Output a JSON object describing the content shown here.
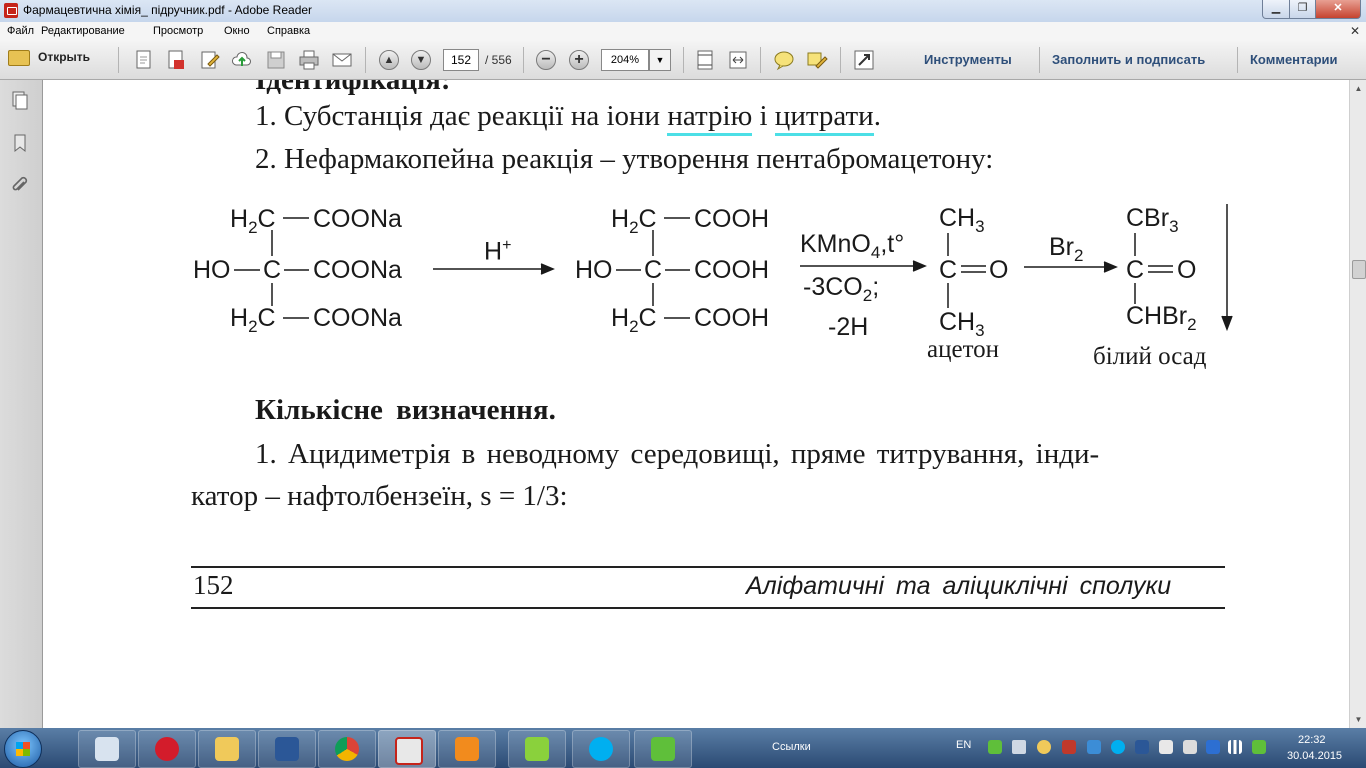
{
  "window": {
    "title": "Фармацевтична хімія_ підручник.pdf - Adobe Reader"
  },
  "menu": [
    "Файл",
    "Редактирование",
    "Просмотр",
    "Окно",
    "Справка"
  ],
  "toolbar": {
    "open_label": "Открыть",
    "page_current": "152",
    "page_total": "/ 556",
    "zoom": "204%",
    "tools_label": "Инструменты",
    "fill_sign_label": "Заполнить и подписать",
    "comments_label": "Комментарии"
  },
  "document": {
    "heading_partial": "Ідентифікація:",
    "item1_prefix": "1. Субстанція дає реакції на іони ",
    "item1_word1": "натрію",
    "item1_mid": " і ",
    "item1_word2": "цитрати",
    "item1_end": ".",
    "item2": "2. Нефармакопейна реакція – утворення пентабромацетону:",
    "reaction": {
      "citrate_top": [
        "H",
        "2",
        "C",
        "COONa"
      ],
      "citrate_mid": [
        "HO",
        "C",
        "COONa"
      ],
      "citrate_bot": [
        "H",
        "2",
        "C",
        "COONa"
      ],
      "reagent1": "H",
      "reagent1_sup": "+",
      "acid_top": [
        "H",
        "2",
        "C",
        "COOH"
      ],
      "acid_mid": [
        "HO",
        "C",
        "COOH"
      ],
      "acid_bot": [
        "H",
        "2",
        "C",
        "COOH"
      ],
      "reagent2_top": "KMnO",
      "reagent2_top_sub": "4",
      "reagent2_top_end": ",t°",
      "reagent2_bot1": "-3CO",
      "reagent2_bot1_sub": "2",
      "reagent2_bot1_end": ";",
      "reagent2_bot2": "-2H",
      "acetone_top": "CH",
      "acetone_top_sub": "3",
      "acetone_mid": [
        "C",
        "O"
      ],
      "acetone_bot": "CH",
      "acetone_bot_sub": "3",
      "acetone_label": "ацетон",
      "reagent3": "Br",
      "reagent3_sub": "2",
      "product_top": "CBr",
      "product_top_sub": "3",
      "product_mid": [
        "C",
        "O"
      ],
      "product_bot": "CHBr",
      "product_bot_sub": "2",
      "product_label": "білий осад"
    },
    "quant_heading": "Кількісне визначення.",
    "quant_line1": "1. Ацидиметрія в неводному середовищі, пряме титрування, інди-",
    "quant_line2": "катор – нафтолбензеїн, s = 1/3:",
    "footer_page": "152",
    "footer_title": "Аліфатичні та аліциклічні сполуки"
  },
  "taskbar": {
    "apps": [
      "file-manager",
      "virgin-media",
      "folder",
      "word",
      "chrome",
      "adobe-reader",
      "media-player",
      "music",
      "skype",
      "green-app"
    ],
    "links_label": "Ссылки",
    "lang": "EN",
    "time": "22:32",
    "date": "30.04.2015"
  },
  "colors": {
    "highlight": "#4cdfe6",
    "taskbar": "#2b4a73"
  }
}
